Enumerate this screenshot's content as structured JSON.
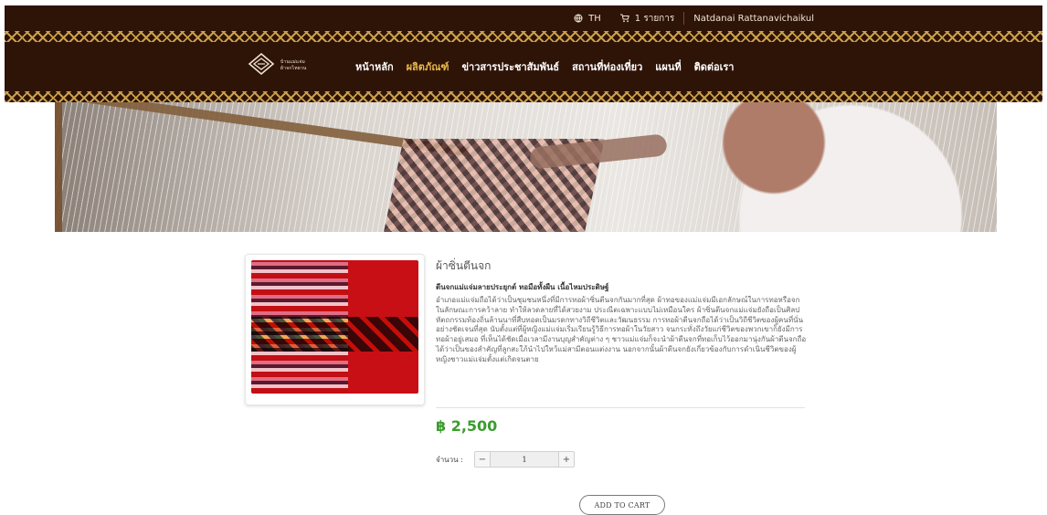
{
  "colors": {
    "header_bg": "#2e1307",
    "pattern_accent": "#c9a04c",
    "nav_active": "#e6b64a",
    "price": "#3a9d2e"
  },
  "topbar": {
    "language": {
      "icon": "globe-icon",
      "label": "TH"
    },
    "cart": {
      "icon": "cart-icon",
      "label": "1 รายการ"
    },
    "user_name": "Natdanai Rattanavichaikul"
  },
  "brand": {
    "logo_icon": "diamond-logo-icon",
    "logo_text_lines": [
      "บ้านแม่แจ่ม",
      "ผ้าจกไทยวน"
    ]
  },
  "nav": {
    "items": [
      {
        "label": "หน้าหลัก"
      },
      {
        "label": "ผลิตภัณฑ์",
        "active": true
      },
      {
        "label": "ข่าวสารประชาสัมพันธ์"
      },
      {
        "label": "สถานที่ท่องเที่ยว"
      },
      {
        "label": "แผนที่"
      },
      {
        "label": "ติดต่อเรา"
      }
    ]
  },
  "product": {
    "title": "ผ้าซิ่นตีนจก",
    "subtitle": "ตีนจกแม่แจ่มลายประยุกต์ ทอมือทั้งผืน เนื้อไหมประดิษฐ์",
    "description": "อำเภอแม่แจ่มถือได้ว่าเป็นชุมชนหนึ่งที่มีการทอผ้าซิ่นตีนจกกันมากที่สุด ผ้าทอของแม่แจ่มมีเอกลักษณ์ในการทอหรือจกในลักษณะการคว้าลาย ทำให้ลวดลายที่ได้สวยงาม ประณีตเฉพาะแบบไม่เหมือนใคร ผ้าซิ่นตีนจกแม่แจ่มยังถือเป็นศิลปหัตถกรรมท้องถิ่นล้านนาที่สืบทอดเป็นมรดกทางวิถีชีวิตและวัฒนธรรม การทอผ้าตีนจกถือได้ว่าเป็นวิถีชีวิตของผู้คนที่นั่นอย่างชัดเจนที่สุด นับตั้งแต่ที่ผู้หญิงแม่แจ่มเริ่มเรียนรู้วิธีการทอผ้าในวัยสาว จนกระทั่งถึงวัยแก่ชีวิตของพวกเขาก็ยังมีการทอผ้าอยู่เสมอ ที่เห็นได้ชัดเมื่อเวลามีงานบุญสำคัญต่าง ๆ ชาวแม่แจ่มก็จะนำผ้าตีนจกที่ทอเก็บไว้ออกมานุ่งกันผ้าตีนจกถือได้ว่าเป็นของสำคัญที่ลูกสะใภ้นำไปใหว้แม่สามีตอนแต่งงาน นอกจากนั้นผ้าตีนจกยังเกี่ยวข้องกับการดำเนินชีวิตของผู้หญิงชาวแม่แจ่มตั้งแต่เกิดจนตาย",
    "price": "฿ 2,500",
    "quantity_label": "จำนวน :",
    "quantity_value": "1",
    "add_to_cart": "ADD TO CART"
  }
}
